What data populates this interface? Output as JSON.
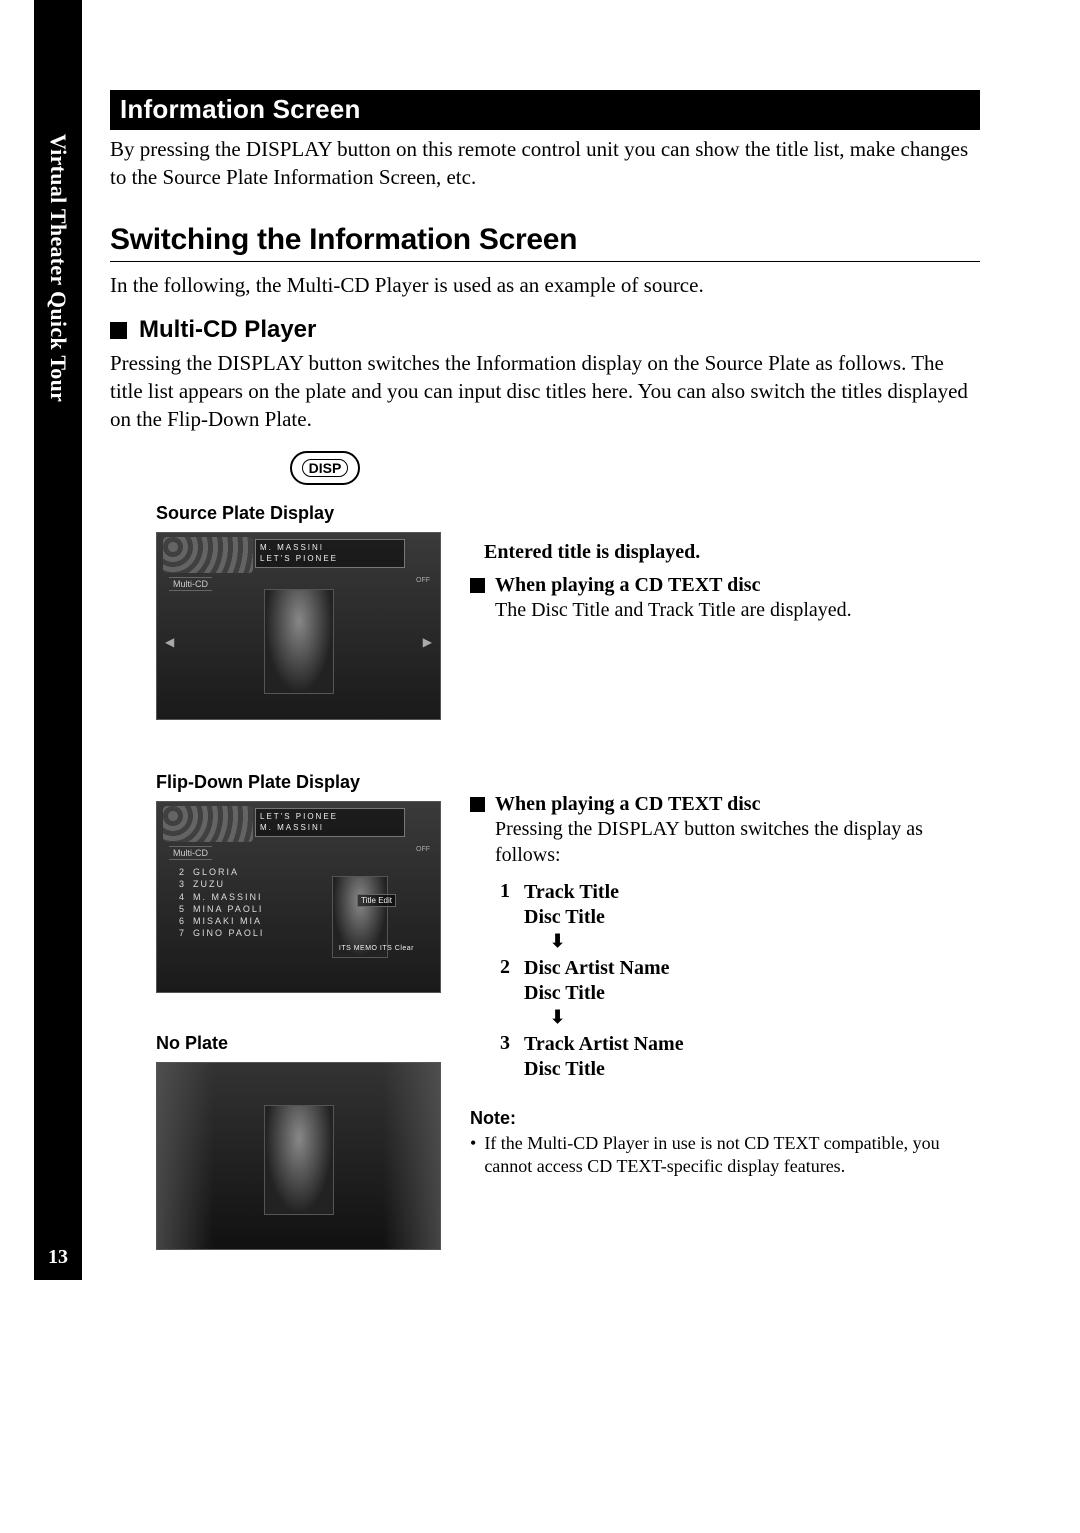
{
  "side_tab": "Virtual Theater Quick Tour",
  "page_number": "13",
  "banner": "Information Screen",
  "intro": "By pressing the DISPLAY button on this remote control unit you can show the title list, make changes to the Source Plate Information Screen, etc.",
  "section_title": "Switching the Information Screen",
  "section_para": "In the following, the Multi-CD Player is used as an example of source.",
  "sub_title": "Multi-CD Player",
  "sub_para": "Pressing the DISPLAY button switches the Information display on the Source Plate as follows. The title list appears on the plate and you can input disc titles here. You can also switch the titles displayed on the Flip-Down Plate.",
  "disp_label": "DISP",
  "captions": {
    "source": "Source Plate Display",
    "flip": "Flip-Down Plate Display",
    "no_plate": "No Plate"
  },
  "shot1": {
    "line1": "M. MASSINI",
    "line2": "LET'S  PIONEE",
    "multi": "Multi-CD",
    "off": "OFF"
  },
  "shot2": {
    "line1": "LET'S  PIONEE",
    "line2": "M. MASSINI",
    "multi": "Multi-CD",
    "off": "OFF",
    "title_edit": "Title Edit",
    "its": "ITS MEMO ITS Clear",
    "list": [
      {
        "n": "2",
        "t": "GLORIA"
      },
      {
        "n": "3",
        "t": "ZUZU"
      },
      {
        "n": "4",
        "t": "M. MASSINI"
      },
      {
        "n": "5",
        "t": "MINA  PAOLI"
      },
      {
        "n": "6",
        "t": "MISAKI  MIA"
      },
      {
        "n": "7",
        "t": "GINO  PAOLI"
      }
    ]
  },
  "right1": {
    "lead": "Entered title is displayed.",
    "head": "When playing a CD TEXT disc",
    "body": "The Disc Title and Track Title are displayed."
  },
  "right2": {
    "head": "When playing a CD TEXT disc",
    "body": "Pressing the DISPLAY button switches the display as follows:",
    "seq": [
      {
        "n": "1",
        "a": "Track Title",
        "b": "Disc Title"
      },
      {
        "n": "2",
        "a": "Disc Artist Name",
        "b": "Disc Title"
      },
      {
        "n": "3",
        "a": "Track Artist Name",
        "b": "Disc Title"
      }
    ],
    "arrow": "⬇",
    "note_head": "Note:",
    "note_body": "If the Multi-CD Player in use is not CD TEXT compatible, you cannot access CD TEXT-specific display features."
  }
}
